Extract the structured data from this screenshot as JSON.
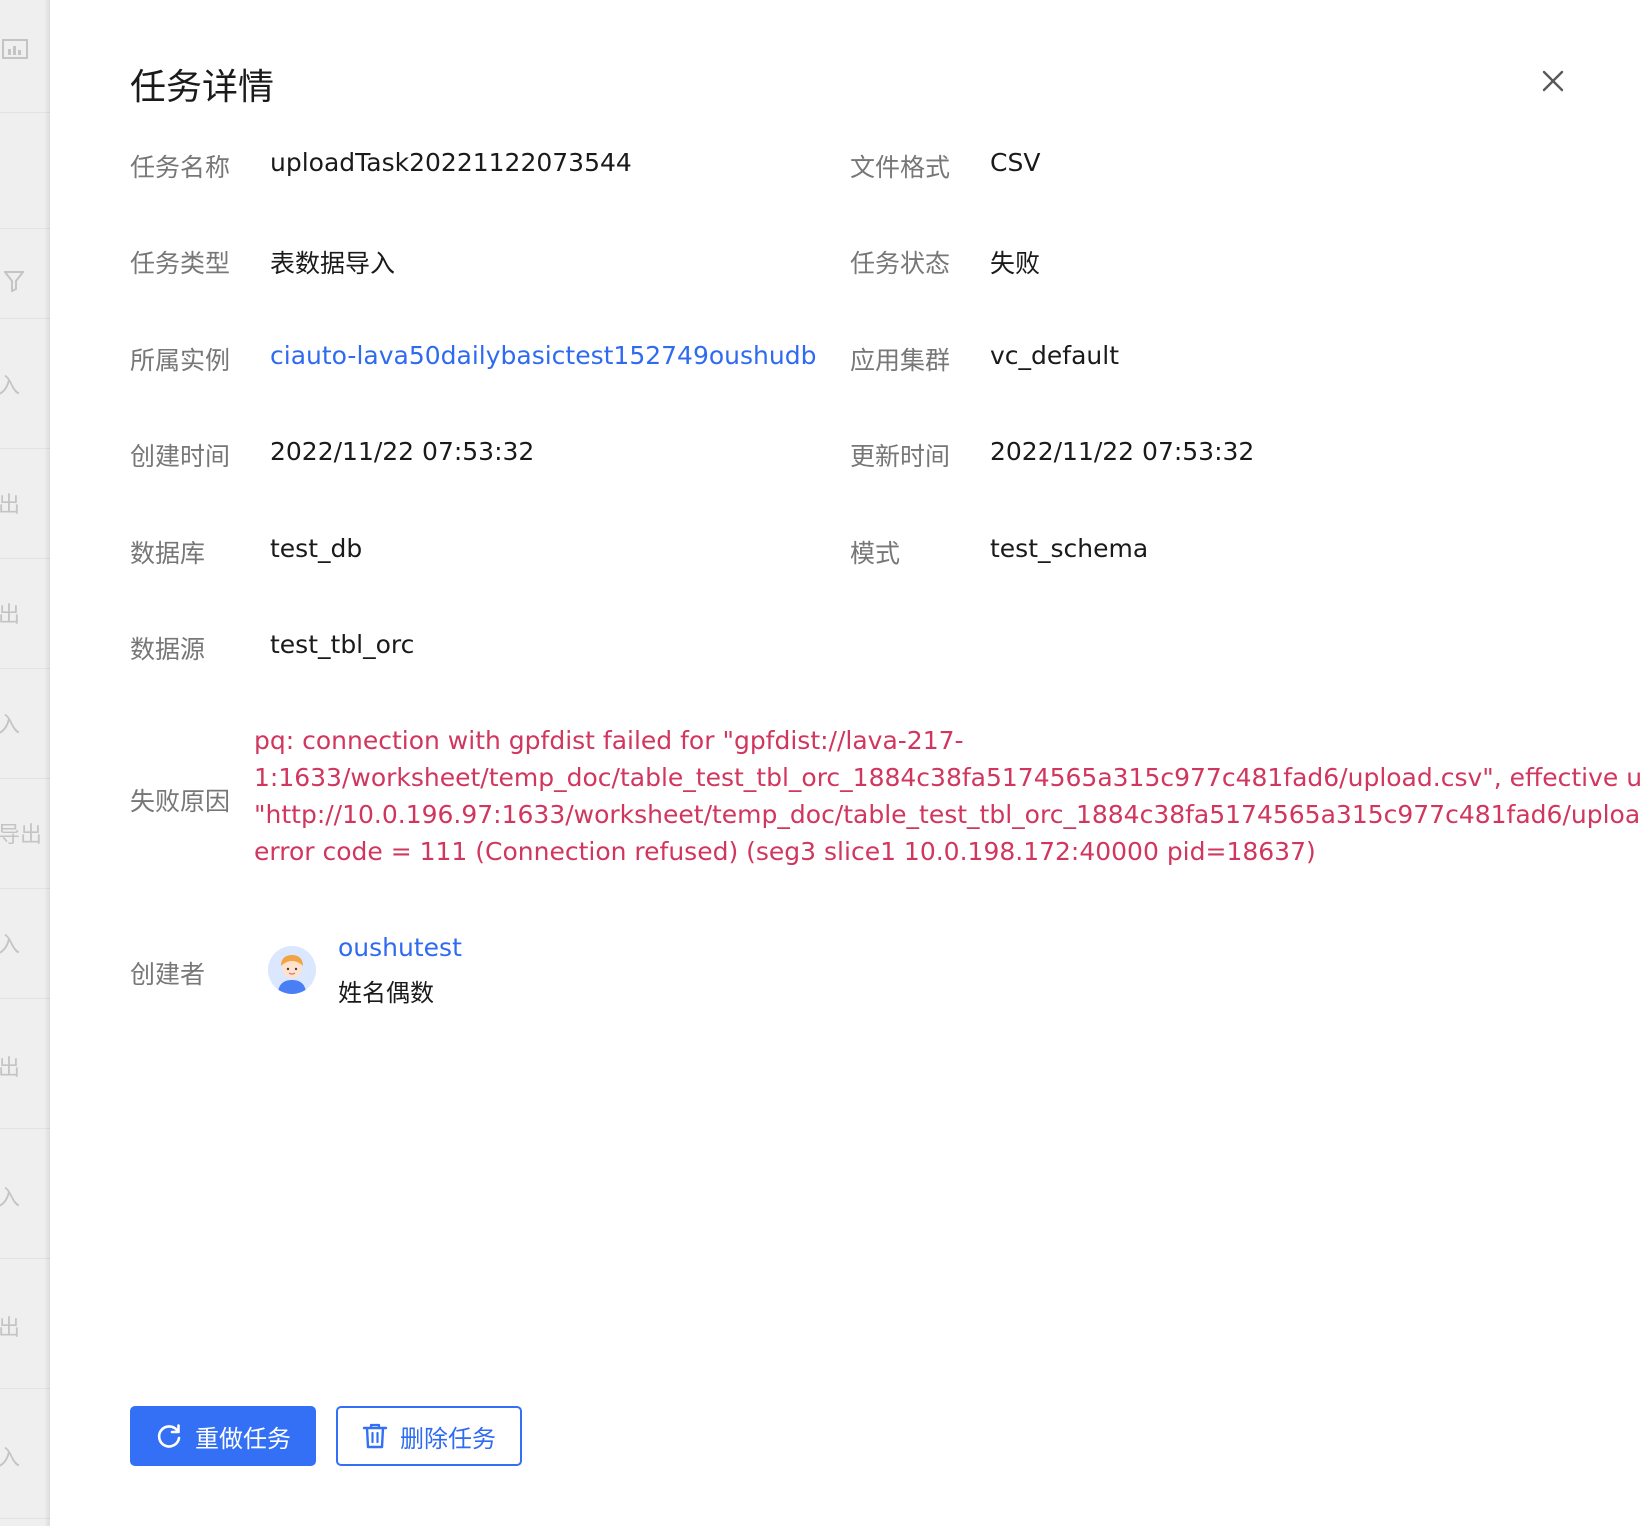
{
  "background": {
    "items": [
      "入",
      "出",
      "出",
      "入",
      "导出",
      "入",
      "出",
      "入",
      "出",
      "入"
    ]
  },
  "drawer": {
    "title": "任务详情",
    "fields": {
      "task_name": {
        "label": "任务名称",
        "value": "uploadTask20221122073544"
      },
      "file_format": {
        "label": "文件格式",
        "value": "CSV"
      },
      "task_type": {
        "label": "任务类型",
        "value": "表数据导入"
      },
      "task_status": {
        "label": "任务状态",
        "value": "失败"
      },
      "instance": {
        "label": "所属实例",
        "value": "ciauto-lava50dailybasictest152749oushudb"
      },
      "cluster": {
        "label": "应用集群",
        "value": "vc_default"
      },
      "created_at": {
        "label": "创建时间",
        "value": "2022/11/22 07:53:32"
      },
      "updated_at": {
        "label": "更新时间",
        "value": "2022/11/22 07:53:32"
      },
      "database": {
        "label": "数据库",
        "value": "test_db"
      },
      "schema": {
        "label": "模式",
        "value": "test_schema"
      },
      "datasource": {
        "label": "数据源",
        "value": "test_tbl_orc"
      }
    },
    "failure": {
      "label": "失败原因",
      "lines": [
        "pq: connection with gpfdist failed for \"gpfdist://lava-217-",
        "1:1633/worksheet/temp_doc/table_test_tbl_orc_1884c38fa5174565a315c977c481fad6/upload.csv\", effective ur",
        "\"http://10.0.196.97:1633/worksheet/temp_doc/table_test_tbl_orc_1884c38fa5174565a315c977c481fad6/uploa",
        "error code = 111 (Connection refused) (seg3 slice1 10.0.198.172:40000 pid=18637)"
      ]
    },
    "creator": {
      "label": "创建者",
      "username": "oushutest",
      "display_name": "姓名偶数"
    },
    "actions": {
      "redo_label": "重做任务",
      "delete_label": "删除任务"
    }
  },
  "colors": {
    "primary": "#3370f5",
    "link": "#2f6bf0",
    "error": "#d1365e",
    "label": "#777777"
  }
}
